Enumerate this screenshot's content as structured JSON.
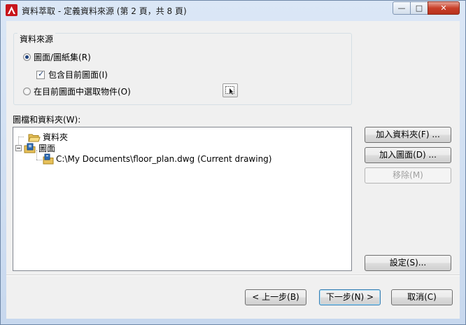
{
  "window": {
    "title": "資料萃取 - 定義資料來源 (第 2 頁，共 8 頁)",
    "controls": {
      "minimize": "—",
      "maximize": "□",
      "close": "✕"
    }
  },
  "source_group": {
    "label": "資料來源",
    "option_drawings": "圖面/圖紙集(R)",
    "include_current": "包含目前圖面(I)",
    "option_select": "在目前圖面中選取物件(O)"
  },
  "tree": {
    "label": "圖檔和資料夾(W):",
    "items": [
      {
        "label": "資料夾"
      },
      {
        "label": "圖面"
      },
      {
        "label": "C:\\My Documents\\floor_plan.dwg (Current drawing)"
      }
    ]
  },
  "side_buttons": {
    "add_folder": "加入資料夾(F) ...",
    "add_drawing": "加入圖面(D) ...",
    "remove": "移除(M)",
    "settings": "設定(S)..."
  },
  "footer": {
    "back": "< 上一步(B)",
    "next": "下一步(N) >",
    "cancel": "取消(C)"
  }
}
